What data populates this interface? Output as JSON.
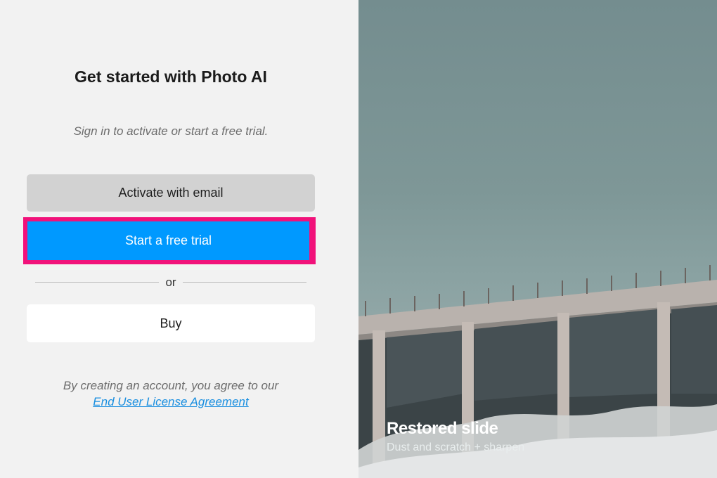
{
  "signin": {
    "title": "Get started with Photo AI",
    "subtitle": "Sign in to activate or start a free trial.",
    "activate_label": "Activate with email",
    "trial_label": "Start a free trial",
    "or_label": "or",
    "buy_label": "Buy",
    "legal_text": "By creating an account, you agree to our",
    "eula_link": "End User License Agreement"
  },
  "showcase": {
    "caption_title": "Restored slide",
    "caption_sub": "Dust and scratch + sharpen"
  },
  "colors": {
    "trial_button": "#0099ff",
    "highlight_border": "#f1127a",
    "activate_button": "#d2d2d2",
    "link": "#1a8fe0"
  }
}
